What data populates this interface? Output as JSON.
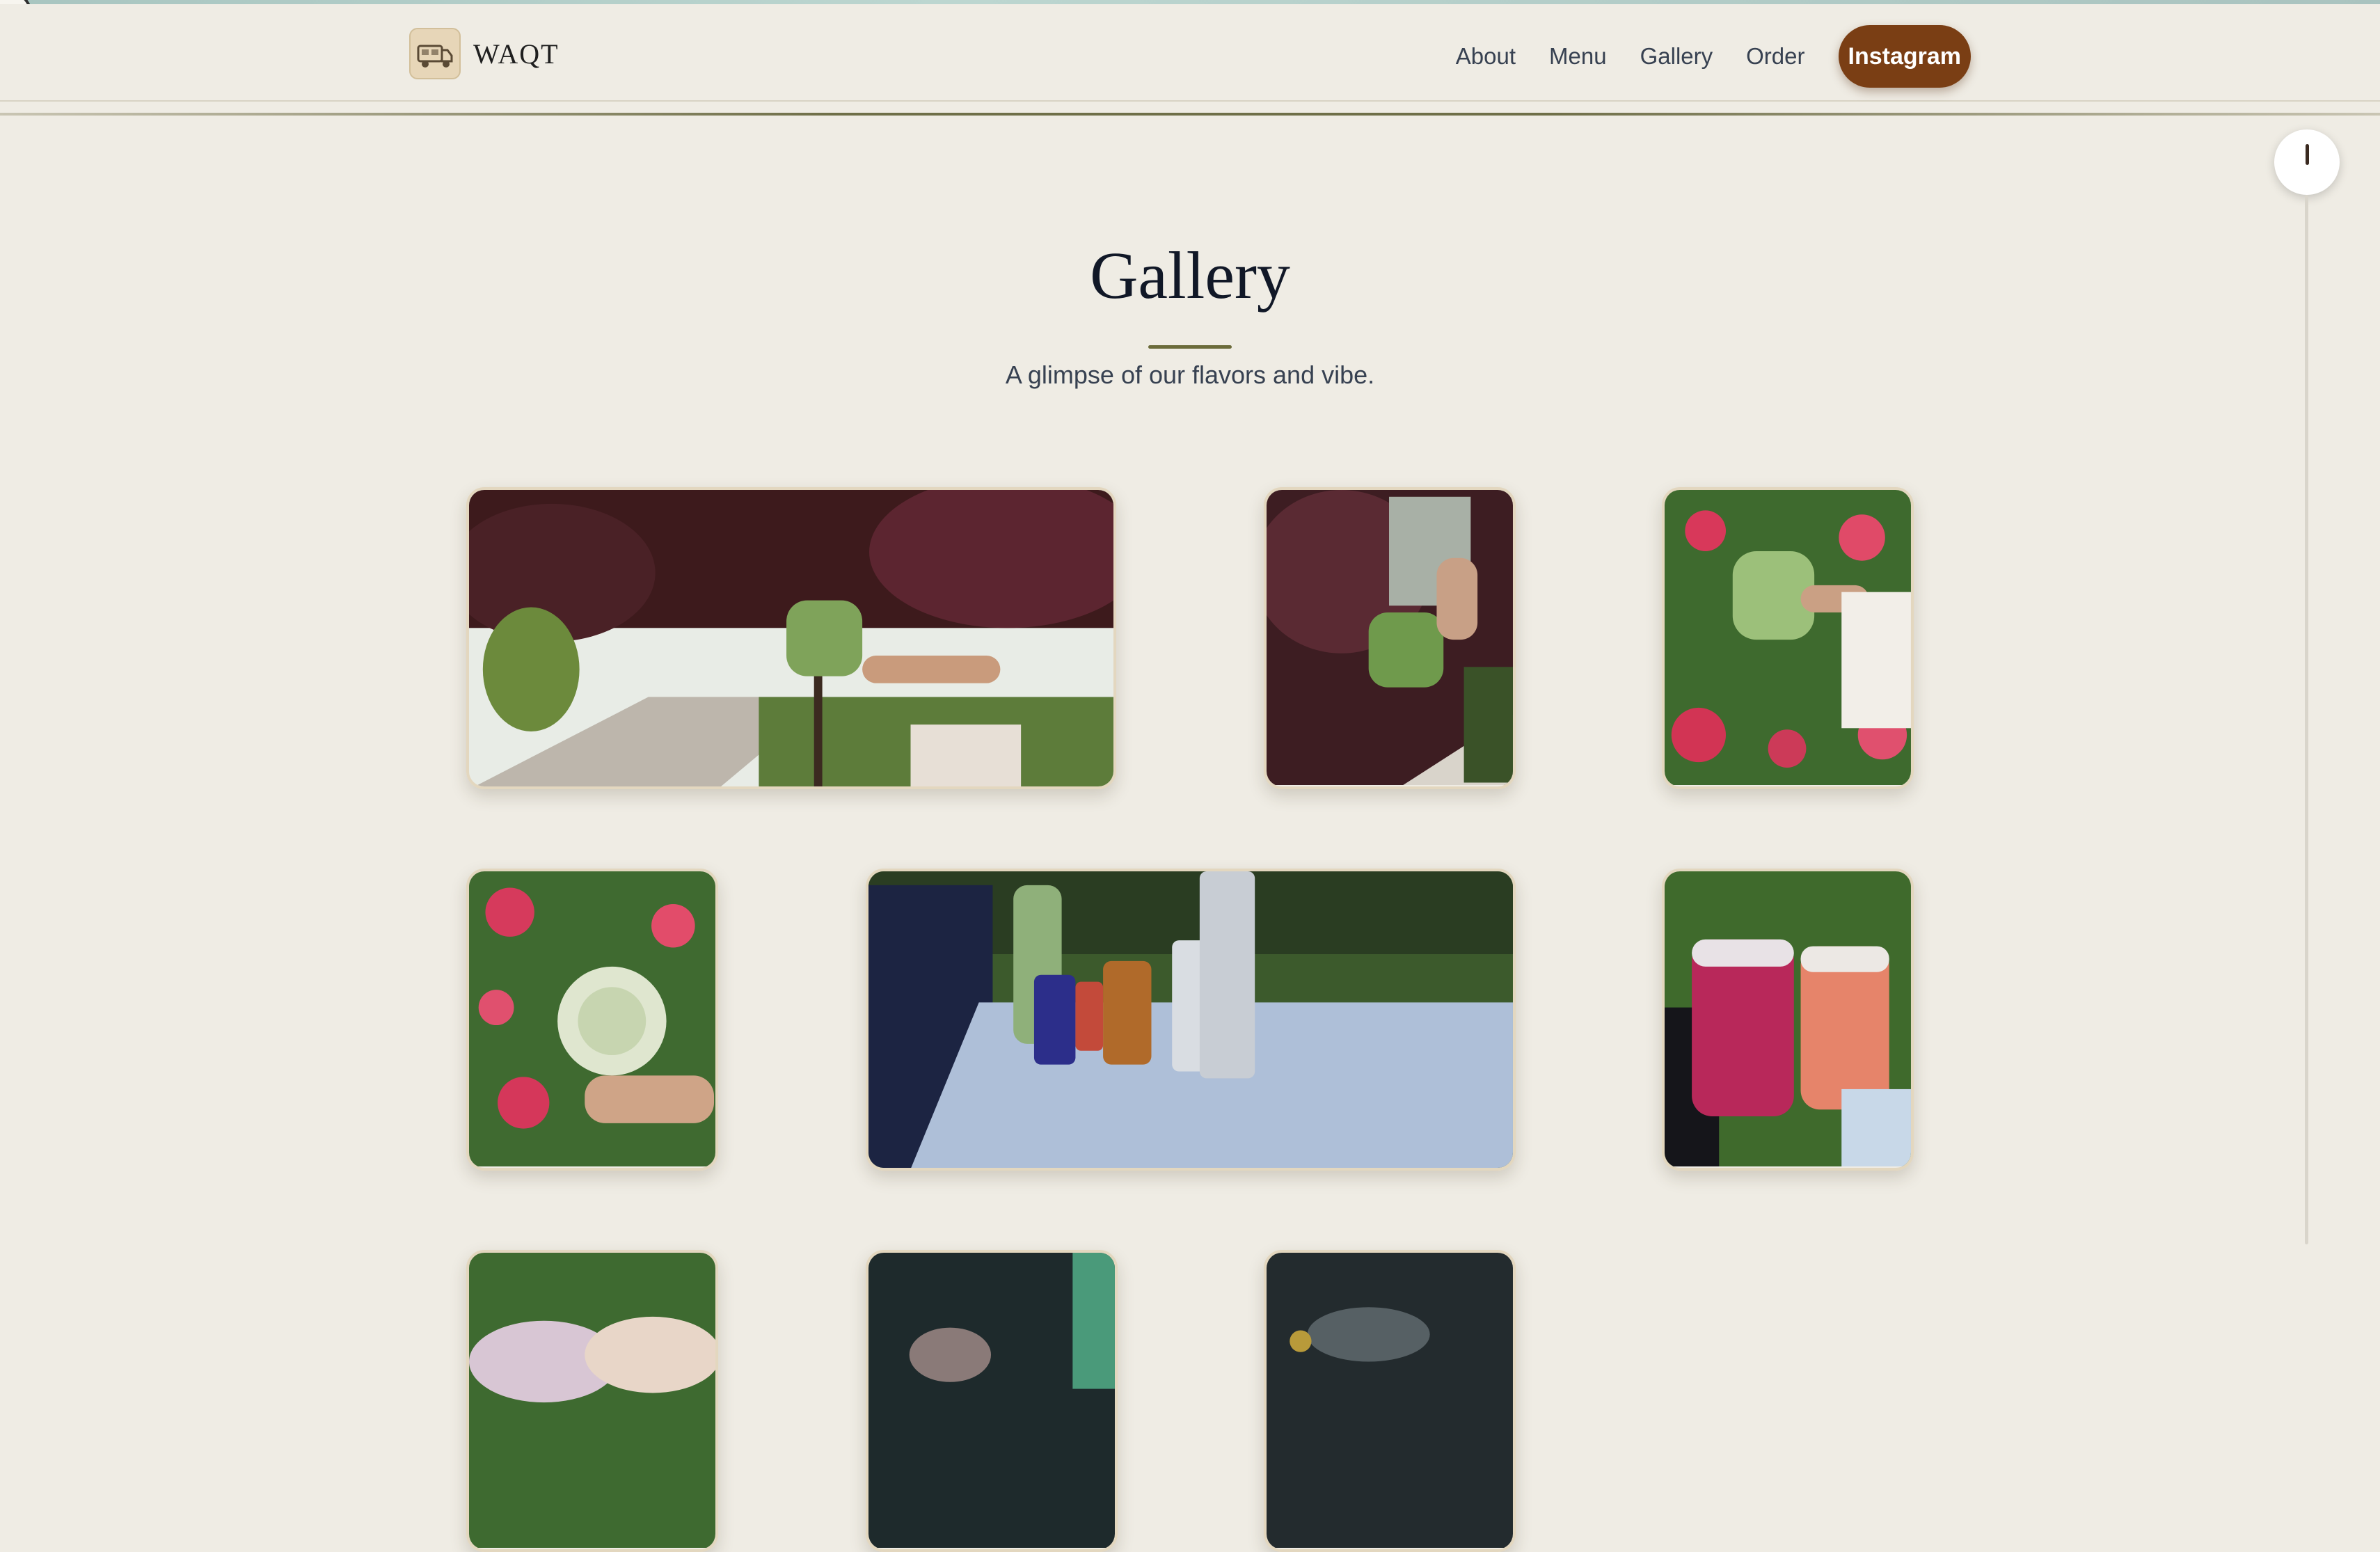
{
  "brand": {
    "name": "WAQT"
  },
  "nav": {
    "items": [
      {
        "label": "About"
      },
      {
        "label": "Menu"
      },
      {
        "label": "Gallery"
      },
      {
        "label": "Order"
      }
    ],
    "cta_label": "Instagram"
  },
  "gallery": {
    "title": "Gallery",
    "subtitle": "A glimpse of our flavors and vibe."
  },
  "colors": {
    "background": "#efece4",
    "accent_brown": "#7a3e14",
    "olive_rule": "#6b6b3a",
    "tile_border": "#e3d7bf"
  },
  "icons": {
    "logo": "food-truck-icon",
    "corner": "clock-icon",
    "scroll": "scroll-knob-icon"
  }
}
